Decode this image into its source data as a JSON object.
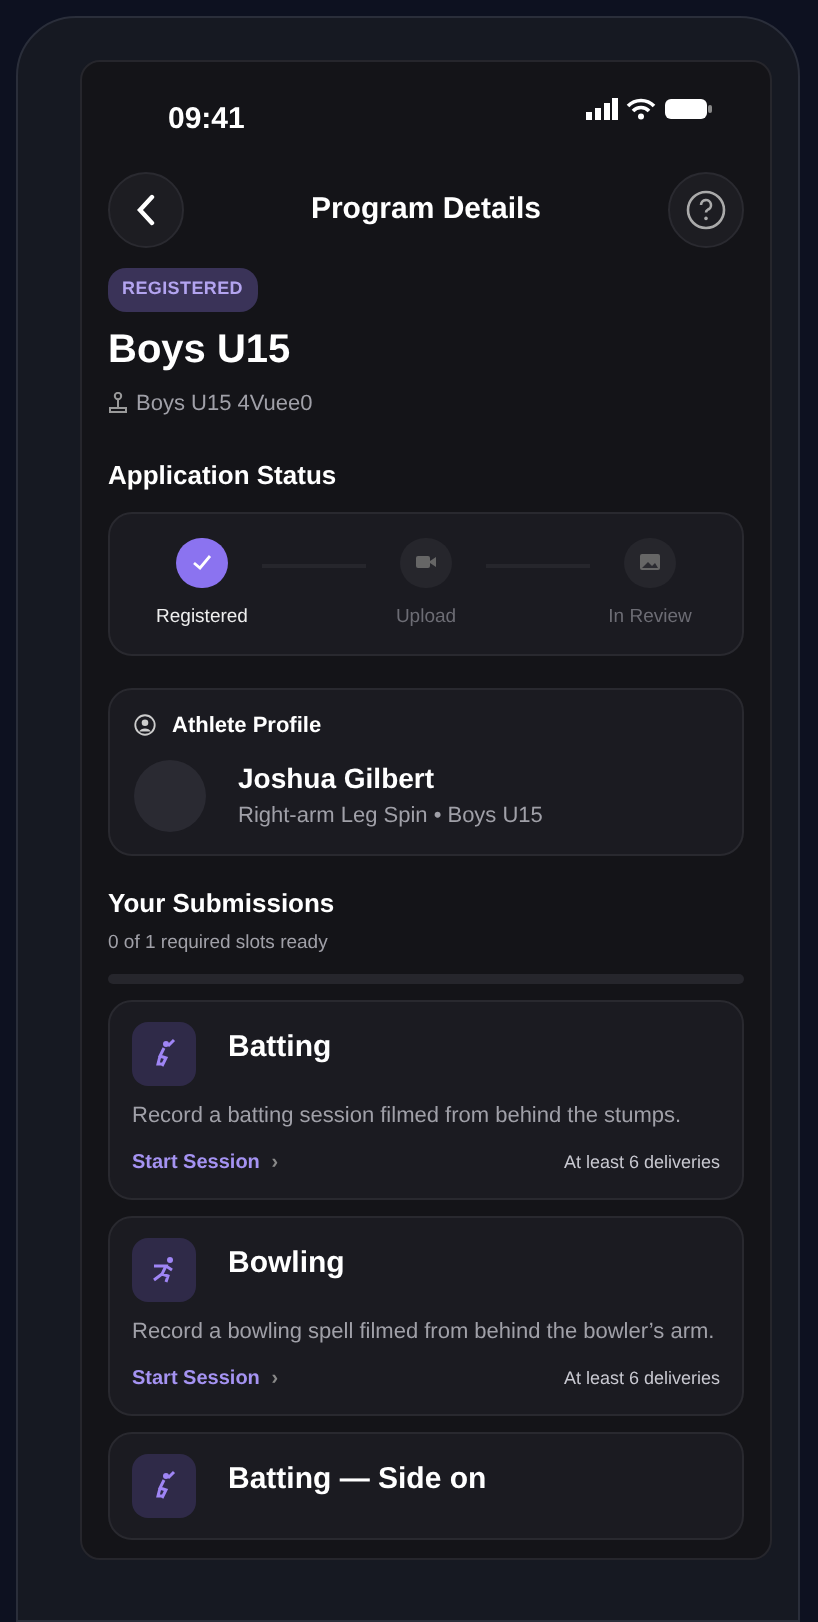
{
  "status_bar": {
    "time": "09:41"
  },
  "header": {
    "title": "Program Details"
  },
  "badge": "REGISTERED",
  "program": {
    "title": "Boys U15",
    "subtitle": "Boys U15 4Vuee0"
  },
  "application_status": {
    "heading": "Application Status",
    "steps": [
      {
        "label": "Registered",
        "kind": "check",
        "completed": true
      },
      {
        "label": "Upload",
        "kind": "video",
        "completed": false
      },
      {
        "label": "In Review",
        "kind": "image",
        "completed": false
      }
    ]
  },
  "athlete_profile": {
    "heading": "Athlete Profile",
    "name": "Joshua Gilbert",
    "details": "Right-arm Leg Spin • Boys U15"
  },
  "submissions": {
    "heading": "Your Submissions",
    "counter": "0 of 1 required slots ready",
    "level": 0,
    "items": [
      {
        "kind": "batting",
        "title": "Batting",
        "description": "Record a batting session filmed from behind the stumps.",
        "action": "Start Session",
        "chevron": "›",
        "requirement": "At least 6 deliveries"
      },
      {
        "kind": "bowling",
        "title": "Bowling",
        "description": "Record a bowling spell filmed from behind the bowler’s arm.",
        "action": "Start Session",
        "chevron": "›",
        "requirement": "At least 6 deliveries"
      },
      {
        "kind": "batting",
        "title": "Batting — Side on"
      }
    ]
  }
}
